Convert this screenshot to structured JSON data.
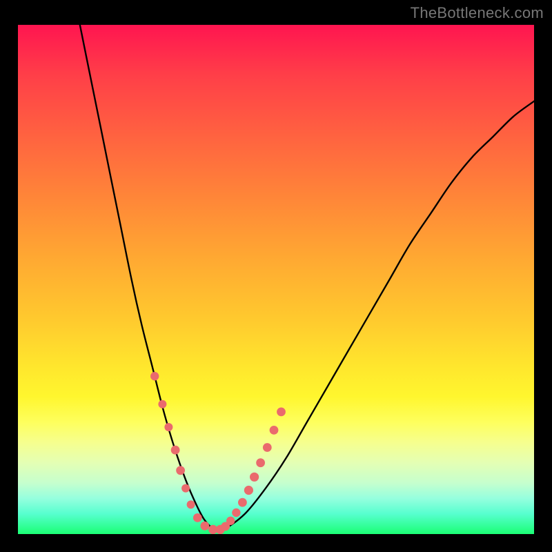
{
  "watermark": "TheBottleneck.com",
  "colors": {
    "frame": "#000000",
    "curve": "#000000",
    "marker": "#ea6a6d"
  },
  "chart_data": {
    "type": "line",
    "title": "",
    "xlabel": "",
    "ylabel": "",
    "xlim": [
      0,
      100
    ],
    "ylim": [
      0,
      100
    ],
    "grid": false,
    "legend": false,
    "series": [
      {
        "name": "bottleneck-curve",
        "x": [
          12,
          14,
          16,
          18,
          20,
          22,
          24,
          26,
          28,
          30,
          32,
          34,
          36,
          38,
          40,
          44,
          48,
          52,
          56,
          60,
          64,
          68,
          72,
          76,
          80,
          84,
          88,
          92,
          96,
          100
        ],
        "y": [
          100,
          90,
          80,
          70,
          60,
          50,
          41,
          33,
          25,
          18,
          12,
          7,
          3,
          1,
          1,
          4,
          9,
          15,
          22,
          29,
          36,
          43,
          50,
          57,
          63,
          69,
          74,
          78,
          82,
          85
        ]
      }
    ],
    "annotations": {
      "marker_cluster": {
        "description": "pink bead markers along the curve near the minimum",
        "x": [
          26.5,
          28.0,
          29.2,
          30.5,
          31.5,
          32.5,
          33.5,
          34.8,
          36.2,
          37.8,
          39.2,
          40.2,
          41.2,
          42.3,
          43.5,
          44.7,
          45.8,
          47.0,
          48.3,
          49.6,
          51.0
        ],
        "y": [
          31.0,
          25.5,
          21.0,
          16.5,
          12.5,
          9.0,
          5.8,
          3.2,
          1.6,
          0.9,
          0.9,
          1.5,
          2.6,
          4.2,
          6.2,
          8.6,
          11.2,
          14.0,
          17.0,
          20.4,
          24.0
        ],
        "r": [
          6.2,
          6.0,
          6.0,
          6.4,
          6.4,
          6.0,
          6.0,
          6.4,
          6.4,
          6.6,
          6.6,
          6.4,
          6.2,
          6.2,
          6.4,
          6.6,
          6.6,
          6.4,
          6.4,
          6.4,
          6.4
        ]
      }
    }
  }
}
